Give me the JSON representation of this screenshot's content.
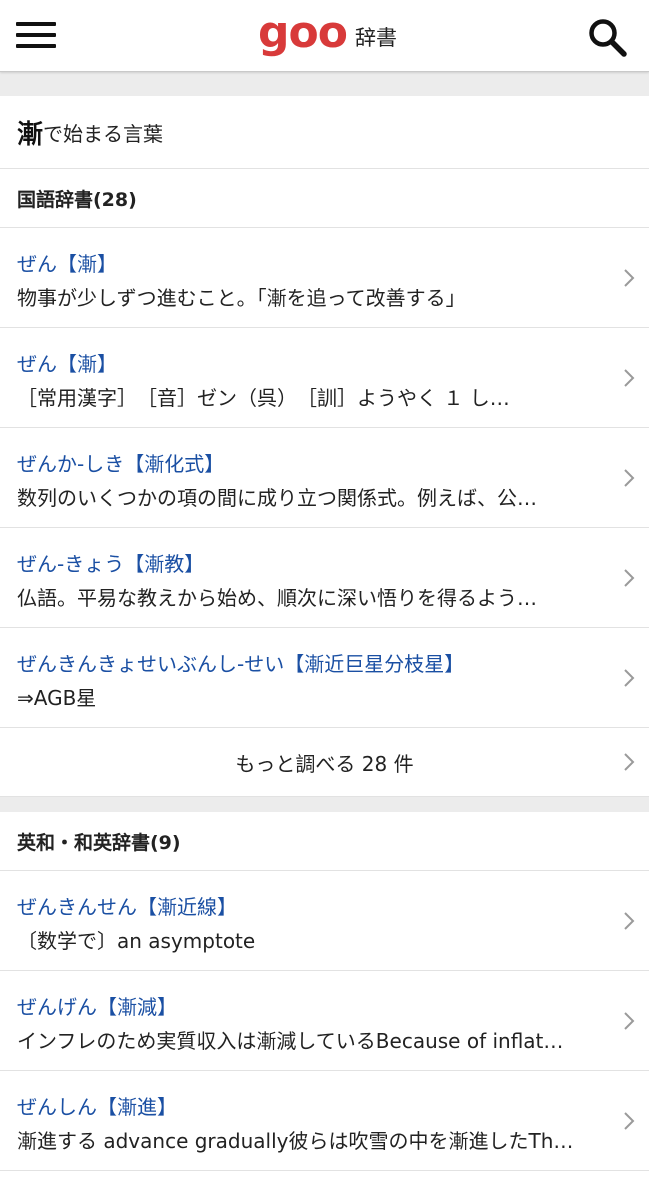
{
  "header": {
    "logo_text": "goo",
    "logo_sub": "辞書",
    "menu_icon": "hamburger-menu-icon",
    "search_icon": "search-icon",
    "logo_color": "#d83a3a"
  },
  "page": {
    "title_kanji": "漸",
    "title_rest": "で始まる言葉"
  },
  "sections": [
    {
      "heading": "国語辞書(28)",
      "entries": [
        {
          "title": "ぜん【漸】",
          "desc": "物事が少しずつ進むこと。「漸を追って改善する」"
        },
        {
          "title": "ぜん【漸】",
          "desc": "［常用漢字］　［音］ゼン（呉）　［訓］ようやく １ し…"
        },
        {
          "title": "ぜんか‐しき【漸化式】",
          "desc": "数列のいくつかの項の間に成り立つ関係式。例えば、公…"
        },
        {
          "title": "ぜん‐きょう【漸教】",
          "desc": "仏語。平易な教えから始め、順次に深い悟りを得るよう…"
        },
        {
          "title": "ぜんきんきょせいぶんし‐せい【漸近巨星分枝星】",
          "desc": "⇒AGB星"
        }
      ],
      "more": "もっと調べる 28 件"
    },
    {
      "heading": "英和・和英辞書(9)",
      "entries": [
        {
          "title": "ぜんきんせん【漸近線】",
          "desc": "〔数学で〕an asymptote"
        },
        {
          "title": "ぜんげん【漸減】",
          "desc": "インフレのため実質収入は漸減しているBecause of inflat…"
        },
        {
          "title": "ぜんしん【漸進】",
          "desc": "漸進する advance gradually彼らは吹雪の中を漸進したTh…"
        }
      ]
    }
  ],
  "colors": {
    "link_blue": "#1a4fa3",
    "divider": "#e2e2e2",
    "gap_gray": "#ececec"
  }
}
